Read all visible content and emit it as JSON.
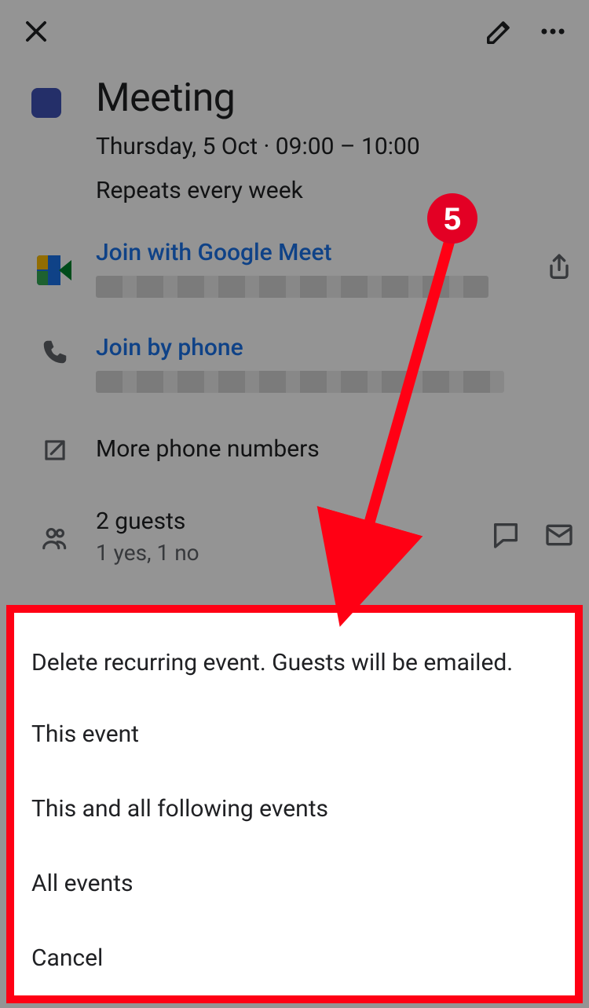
{
  "header": {
    "close_icon": "close",
    "edit_icon": "pencil",
    "more_icon": "more-horizontal"
  },
  "event": {
    "color": "#3f51b5",
    "title": "Meeting",
    "datetime_line": "Thursday, 5 Oct · 09:00 – 10:00",
    "recurrence_line": "Repeats every week"
  },
  "meet": {
    "join_label": "Join with Google Meet",
    "share_icon": "share"
  },
  "phone": {
    "join_label": "Join by phone",
    "more_label": "More phone numbers"
  },
  "guests": {
    "count_label": "2 guests",
    "status_label": "1 yes, 1 no",
    "message_icon": "chat-bubble",
    "email_icon": "envelope"
  },
  "sheet": {
    "title": "Delete recurring event. Guests will be emailed.",
    "options": [
      "This event",
      "This and all following events",
      "All events",
      "Cancel"
    ]
  },
  "annotation": {
    "step_number": "5",
    "badge_color": "#e30024",
    "arrow_color": "#ff0014"
  }
}
